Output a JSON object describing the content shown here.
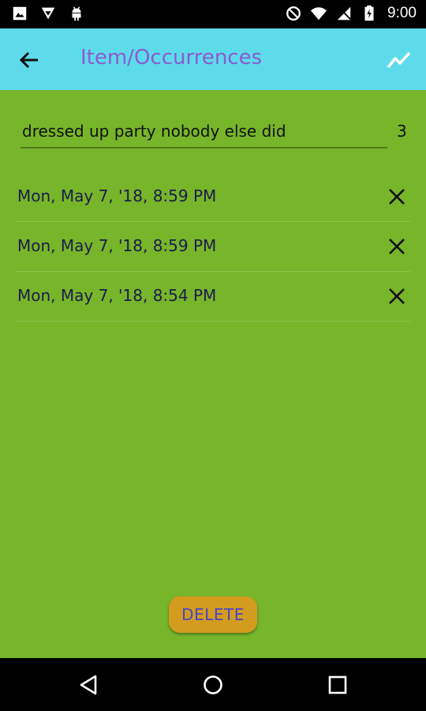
{
  "status_bar": {
    "time": "9:00",
    "icons": [
      "image-icon",
      "download-icon",
      "android-icon",
      "dnd-icon",
      "wifi-icon",
      "signal-icon",
      "battery-icon"
    ]
  },
  "app_bar": {
    "title": "Item/Occurrences",
    "color": "#5ddbeb",
    "title_color": "#8b5bd1"
  },
  "item": {
    "name": "dressed up party nobody else did",
    "count": "3"
  },
  "occurrences": [
    {
      "timestamp": "Mon, May 7, '18, 8:59 PM"
    },
    {
      "timestamp": "Mon, May 7, '18, 8:59 PM"
    },
    {
      "timestamp": "Mon, May 7, '18, 8:54 PM"
    }
  ],
  "delete_button": {
    "label": "DELETE",
    "color": "#d39c1e"
  },
  "background_color": "#77b52b"
}
